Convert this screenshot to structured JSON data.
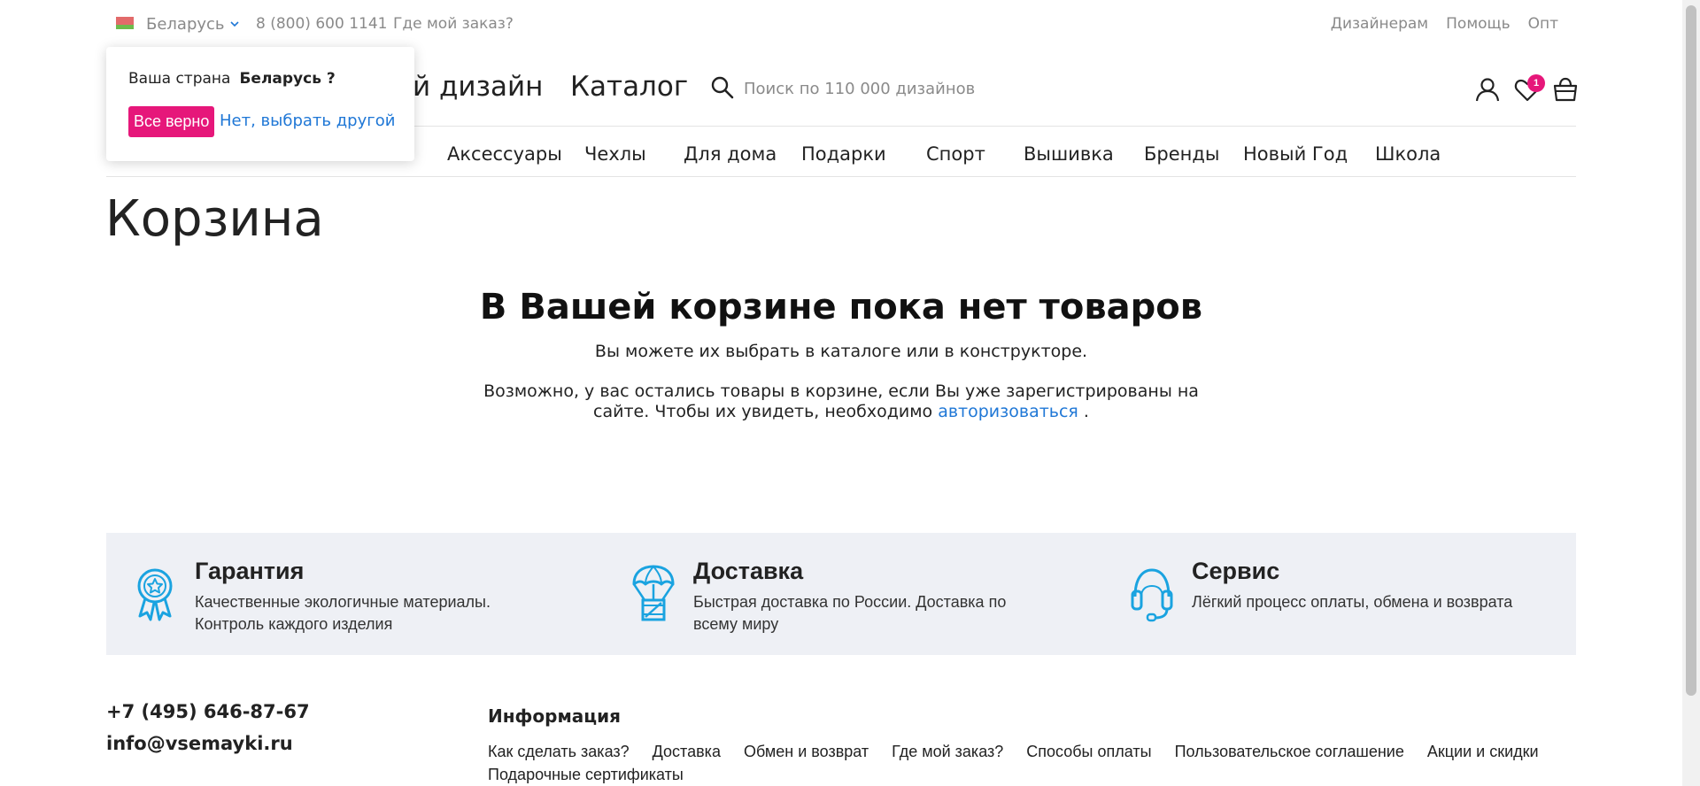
{
  "topbar": {
    "country": "Беларусь",
    "phone": "8 (800) 600 1141",
    "order_link": "Где мой заказ?",
    "links": [
      "Дизайнерам",
      "Помощь",
      "Опт"
    ]
  },
  "header": {
    "design_link": "ой дизайн",
    "catalog_link": "Каталог",
    "search_placeholder": "Поиск по 110 000 дизайнов",
    "wishlist_count": "1",
    "icons": [
      "user-icon",
      "heart-icon",
      "bag-icon",
      "search-icon"
    ]
  },
  "nav": {
    "items": [
      "Аксессуары",
      "Чехлы",
      "Для дома",
      "Подарки",
      "Спорт",
      "Вышивка",
      "Бренды",
      "Новый Год",
      "Школа"
    ]
  },
  "popup": {
    "question": "Ваша страна",
    "country": "Беларусь ?",
    "confirm": "Все верно",
    "change": "Нет, выбрать другой"
  },
  "main": {
    "title": "Корзина",
    "empty_heading": "В Вашей корзине пока нет товаров",
    "empty_text": "Вы можете их выбрать в каталоге или в конструкторе.",
    "note_before": "Возможно, у вас остались товары в корзине, если Вы уже зарегистрированы на сайте. Чтобы их увидеть, необходимо",
    "auth_link": "авторизоваться",
    "note_after": "."
  },
  "features": [
    {
      "title": "Гарантия",
      "desc": "Качественные экологичные материалы. Контроль каждого изделия",
      "icon": "award-icon"
    },
    {
      "title": "Доставка",
      "desc": "Быстрая доставка по России. Доставка по всему миру",
      "icon": "parachute-box-icon"
    },
    {
      "title": "Сервис",
      "desc": "Лёгкий процесс оплаты, обмена и возврата",
      "icon": "headset-icon"
    }
  ],
  "footer": {
    "phone": "+7 (495) 646-87-67",
    "email": "info@vsemayki.ru",
    "info_title": "Информация",
    "links": [
      "Как сделать заказ?",
      "Доставка",
      "Обмен и возврат",
      "Где мой заказ?",
      "Способы оплаты",
      "Пользовательское соглашение",
      "Акции и скидки",
      "Подарочные сертификаты"
    ]
  },
  "colors": {
    "accent": "#e6177a",
    "link": "#1f77d6",
    "feature_icon": "#1aa3e0",
    "feature_bg": "#eef0f5"
  }
}
